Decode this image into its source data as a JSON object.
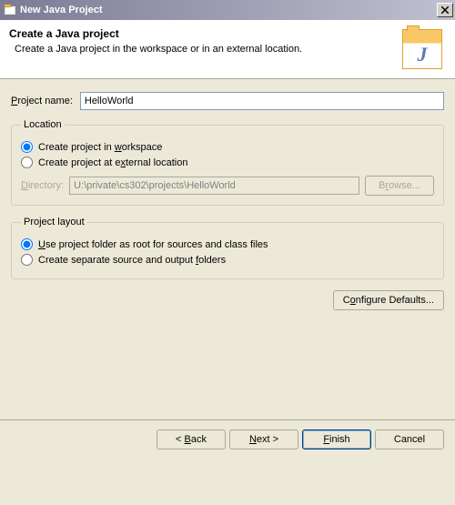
{
  "titlebar": {
    "title": "New Java Project"
  },
  "header": {
    "title": "Create a Java project",
    "description": "Create a Java project in the workspace or in an external location.",
    "icon_letter": "J"
  },
  "form": {
    "project_name_label_pre": "P",
    "project_name_label_post": "roject name:",
    "project_name_value": "HelloWorld"
  },
  "location": {
    "legend": "Location",
    "opt_workspace_pre": "Create project in ",
    "opt_workspace_u": "w",
    "opt_workspace_post": "orkspace",
    "opt_external_pre": "Create project at e",
    "opt_external_u": "x",
    "opt_external_post": "ternal location",
    "dir_label_u": "D",
    "dir_label_post": "irectory:",
    "dir_value": "U:\\private\\cs302\\projects\\HelloWorld",
    "browse_pre": "B",
    "browse_u": "r",
    "browse_post": "owse..."
  },
  "layout": {
    "legend": "Project layout",
    "opt_root_u": "U",
    "opt_root_post": "se project folder as root for sources and class files",
    "opt_separate_pre": "Create separate source and output ",
    "opt_separate_u": "f",
    "opt_separate_post": "olders"
  },
  "config": {
    "label_pre": "C",
    "label_u": "o",
    "label_post": "nfigure Defaults..."
  },
  "buttons": {
    "back_pre": "< ",
    "back_u": "B",
    "back_post": "ack",
    "next_u": "N",
    "next_post": "ext >",
    "finish_u": "F",
    "finish_post": "inish",
    "cancel": "Cancel"
  }
}
